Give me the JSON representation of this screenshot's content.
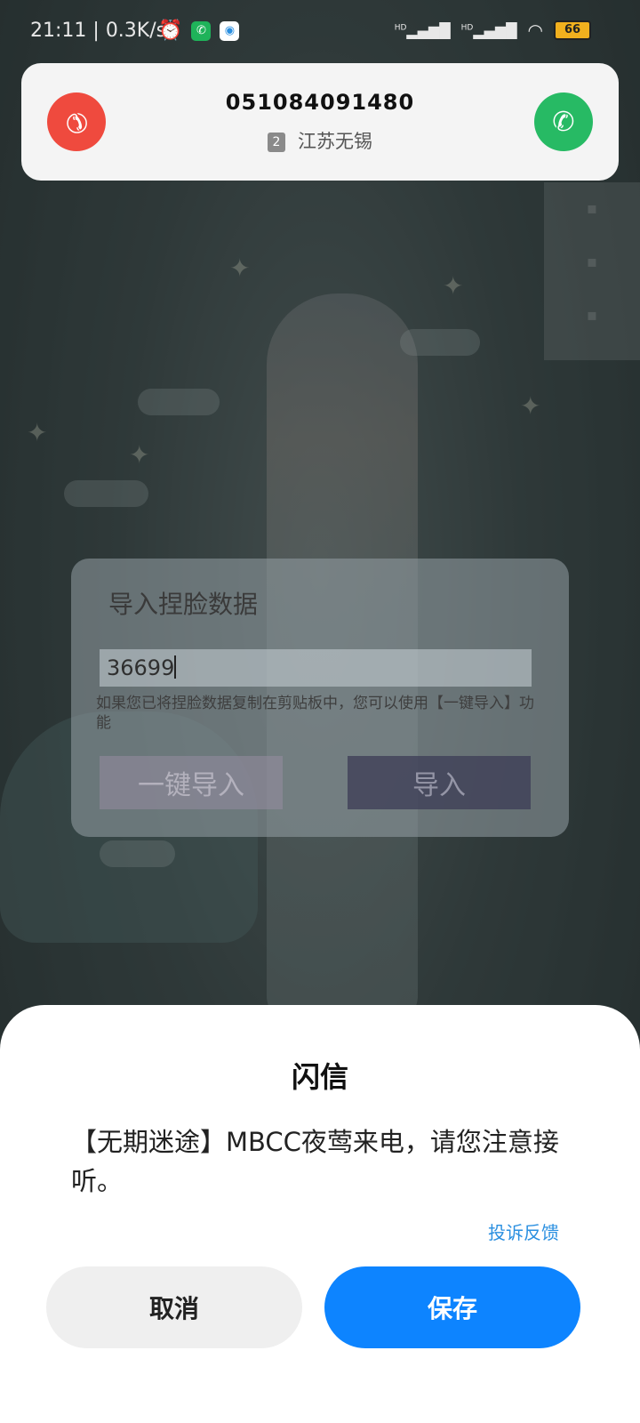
{
  "status_bar": {
    "time": "21:11",
    "speed": "0.3K/s",
    "hd1": "HD",
    "hd2": "HD",
    "battery": "66"
  },
  "incoming_call": {
    "number": "051084091480",
    "sim": "2",
    "location": "江苏无锡",
    "decline_color": "#ef4a3e",
    "accept_color": "#27ba64"
  },
  "import_panel": {
    "title": "导入捏脸数据",
    "input_value": "36699",
    "hint": "如果您已将捏脸数据复制在剪贴板中，您可以使用【一键导入】功能",
    "one_click_label": "一键导入",
    "import_label": "导入"
  },
  "sheet": {
    "title": "闪信",
    "message": "【无期迷途】MBCC夜莺来电，请您注意接听。",
    "feedback_link": "投诉反馈",
    "cancel_label": "取消",
    "save_label": "保存",
    "accent": "#0d84ff"
  }
}
